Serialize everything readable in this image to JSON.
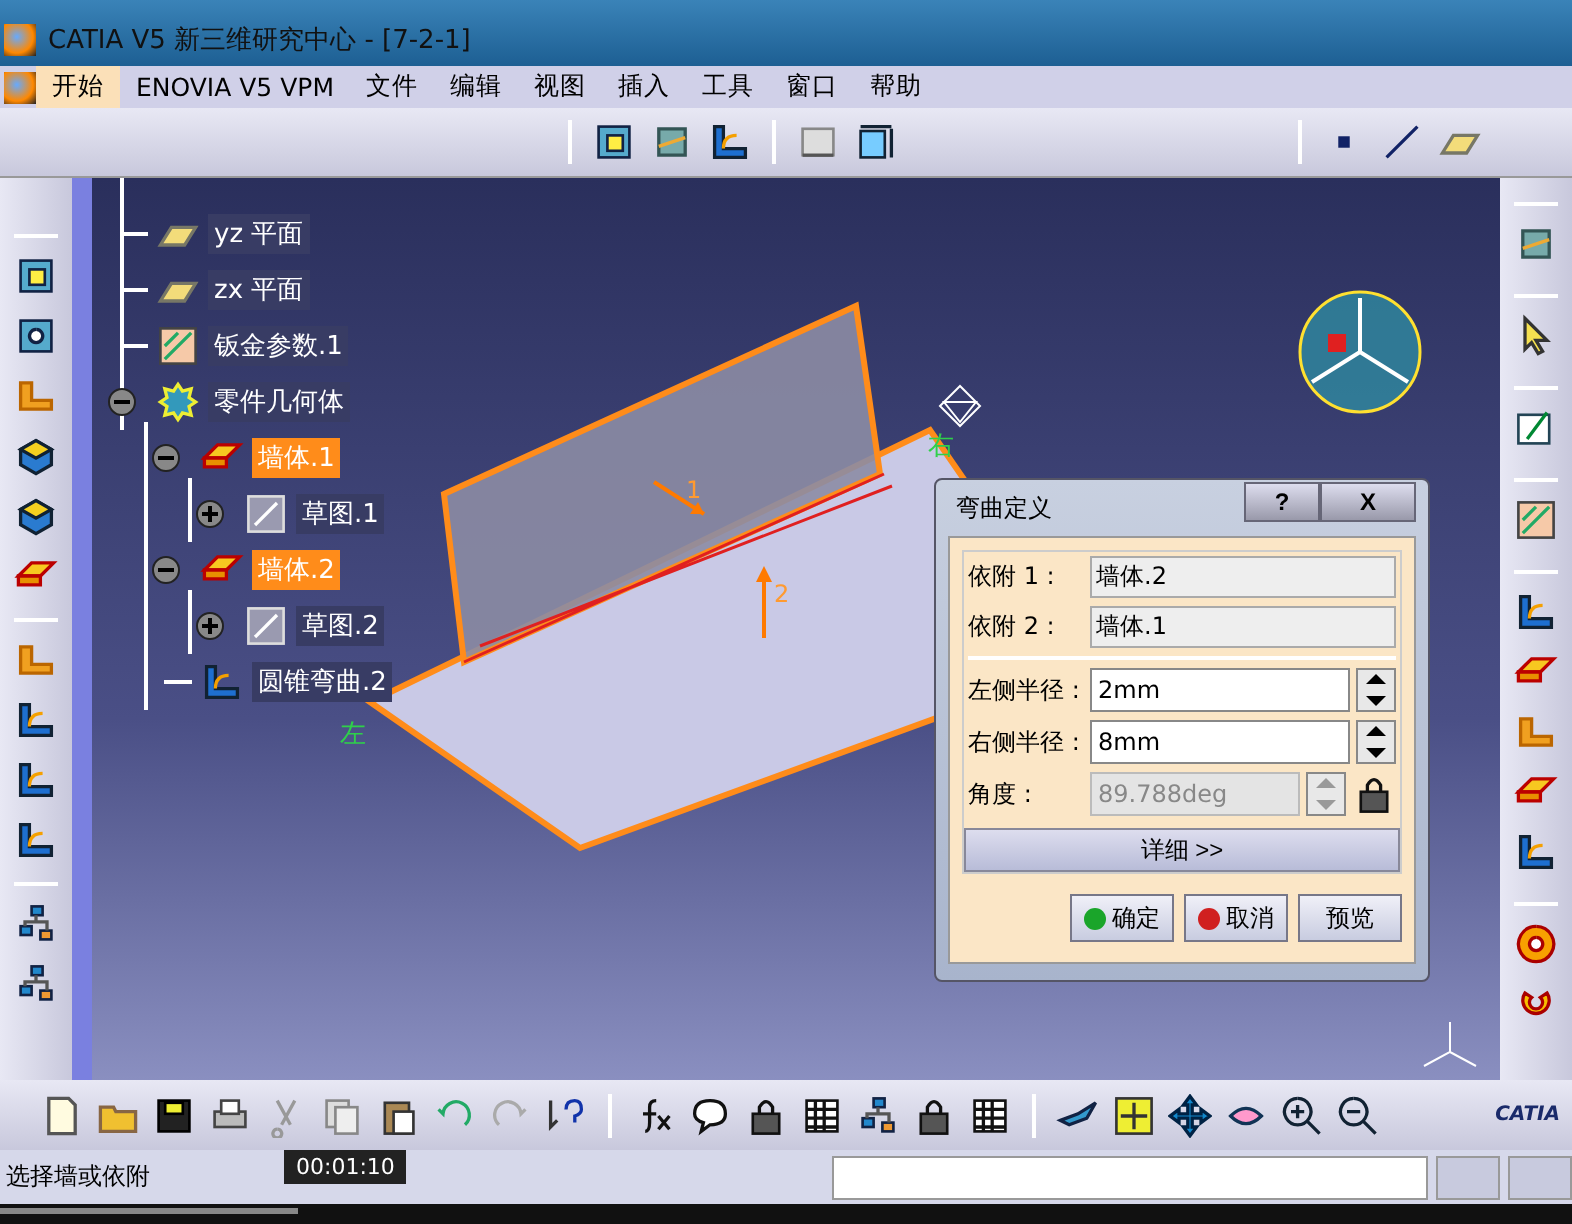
{
  "window": {
    "title": "CATIA V5  新三维研究中心 - [7-2-1]"
  },
  "menu": [
    {
      "label": "开始",
      "selected": true
    },
    {
      "label": "ENOVIA V5 VPM",
      "selected": false
    },
    {
      "label": "文件",
      "selected": false
    },
    {
      "label": "编辑",
      "selected": false
    },
    {
      "label": "视图",
      "selected": false
    },
    {
      "label": "插入",
      "selected": false
    },
    {
      "label": "工具",
      "selected": false
    },
    {
      "label": "窗口",
      "selected": false
    },
    {
      "label": "帮助",
      "selected": false
    }
  ],
  "tree": {
    "items": [
      {
        "label": "yz 平面",
        "kind": "plane",
        "selected": false
      },
      {
        "label": "zx 平面",
        "kind": "plane",
        "selected": false
      },
      {
        "label": "钣金参数.1",
        "kind": "params",
        "selected": false
      },
      {
        "label": "零件几何体",
        "kind": "body",
        "selected": false,
        "expanded": true,
        "children": [
          {
            "label": "墙体.1",
            "kind": "wall",
            "selected": true,
            "expanded": true,
            "children": [
              {
                "label": "草图.1",
                "kind": "sketch",
                "selected": false,
                "expanded": false
              }
            ]
          },
          {
            "label": "墙体.2",
            "kind": "wall",
            "selected": true,
            "expanded": true,
            "children": [
              {
                "label": "草图.2",
                "kind": "sketch",
                "selected": false,
                "expanded": false
              }
            ]
          },
          {
            "label": "圆锥弯曲.2",
            "kind": "bend",
            "selected": false
          }
        ]
      }
    ]
  },
  "viewport": {
    "annotations": [
      "1",
      "2"
    ],
    "side_labels": [
      "左",
      "右"
    ]
  },
  "dialog": {
    "title": "弯曲定义",
    "help": "?",
    "close": "X",
    "fields": [
      {
        "label": "依附 1 :",
        "value": "墙体.2",
        "kind": "readonly",
        "disabled": false
      },
      {
        "label": "依附 2 :",
        "value": "墙体.1",
        "kind": "readonly",
        "disabled": false
      },
      {
        "label": "左侧半径 :",
        "value": "2mm",
        "kind": "spin",
        "disabled": false
      },
      {
        "label": "右侧半径 :",
        "value": "8mm",
        "kind": "spin",
        "disabled": false
      },
      {
        "label": "角度 :",
        "value": "89.788deg",
        "kind": "locked",
        "disabled": true
      }
    ],
    "more_button": "详细 >>",
    "buttons": [
      {
        "label": "确定",
        "kind": "ok"
      },
      {
        "label": "取消",
        "kind": "cancel"
      },
      {
        "label": "预览",
        "kind": "plain"
      }
    ]
  },
  "logo": {
    "text": "CATIA"
  },
  "status_bar": {
    "prompt": "选择墙或依附"
  },
  "video": {
    "tooltip": "00:01:10",
    "level": 0.19
  }
}
